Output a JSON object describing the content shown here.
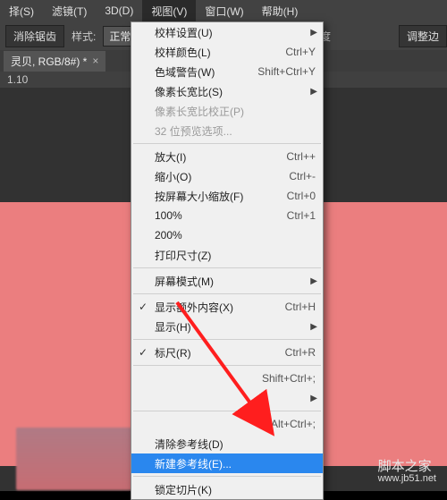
{
  "menubar": {
    "items": [
      "择(S)",
      "滤镜(T)",
      "3D(D)",
      "视图(V)",
      "窗口(W)",
      "帮助(H)"
    ],
    "activeIndex": 3
  },
  "options": {
    "antialias": "消除锯齿",
    "styleLabel": "样式:",
    "styleValue": "正常",
    "degreeLabel": "度",
    "adjustEdge": "调整边"
  },
  "tab": {
    "title": "灵贝, RGB/8#) *",
    "close": "×"
  },
  "zoom": {
    "value": "1.10"
  },
  "dropdown": {
    "items": [
      {
        "label": "校样设置(U)",
        "submenu": true
      },
      {
        "label": "校样颜色(L)",
        "accelerator": "Ctrl+Y"
      },
      {
        "label": "色域警告(W)",
        "accelerator": "Shift+Ctrl+Y"
      },
      {
        "label": "像素长宽比(S)",
        "submenu": true
      },
      {
        "label": "像素长宽比校正(P)",
        "disabled": true
      },
      {
        "label": "32 位预览选项...",
        "disabled": true
      },
      {
        "sep": true
      },
      {
        "label": "放大(I)",
        "accelerator": "Ctrl++"
      },
      {
        "label": "缩小(O)",
        "accelerator": "Ctrl+-"
      },
      {
        "label": "按屏幕大小缩放(F)",
        "accelerator": "Ctrl+0"
      },
      {
        "label": "100%",
        "accelerator": "Ctrl+1"
      },
      {
        "label": "200%"
      },
      {
        "label": "打印尺寸(Z)"
      },
      {
        "sep": true
      },
      {
        "label": "屏幕模式(M)",
        "submenu": true
      },
      {
        "sep": true
      },
      {
        "label": "显示额外内容(X)",
        "checked": true,
        "accelerator": "Ctrl+H"
      },
      {
        "label": "显示(H)",
        "submenu": true
      },
      {
        "sep": true
      },
      {
        "label": "标尺(R)",
        "checked": true,
        "accelerator": "Ctrl+R"
      },
      {
        "sep": true
      },
      {
        "label": "",
        "accelerator": "Shift+Ctrl+;"
      },
      {
        "label": "",
        "submenu": true
      },
      {
        "sep": true
      },
      {
        "label": "",
        "accelerator": "Alt+Ctrl+;"
      },
      {
        "label": "清除参考线(D)"
      },
      {
        "label": "新建参考线(E)...",
        "highlight": true
      },
      {
        "sep": true
      },
      {
        "label": "锁定切片(K)"
      }
    ]
  },
  "watermark": {
    "title": "脚本之家",
    "url": "www.jb51.net"
  }
}
